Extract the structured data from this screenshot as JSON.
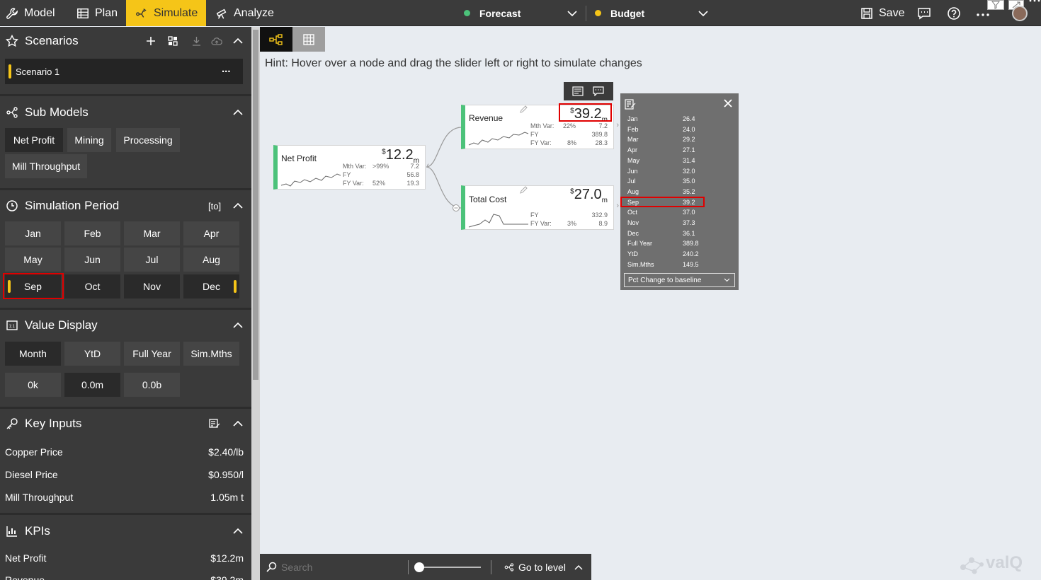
{
  "topbar": {
    "tabs": [
      {
        "label": "Model",
        "icon": "wrench-icon"
      },
      {
        "label": "Plan",
        "icon": "table-icon"
      },
      {
        "label": "Simulate",
        "icon": "simulate-icon"
      },
      {
        "label": "Analyze",
        "icon": "telescope-icon"
      }
    ],
    "forecast_selector": {
      "label": "Forecast",
      "color": "#4cc27a"
    },
    "budget_selector": {
      "label": "Budget",
      "color": "#f5c518"
    },
    "save_label": "Save"
  },
  "sidebar": {
    "scenarios": {
      "title": "Scenarios",
      "items": [
        {
          "label": "Scenario 1",
          "menu": "..."
        }
      ]
    },
    "sub_models": {
      "title": "Sub Models",
      "items": [
        "Net Profit",
        "Mining",
        "Processing",
        "Mill Throughput"
      ]
    },
    "simulation_period": {
      "title": "Simulation Period",
      "mode_label": "[to]",
      "months": [
        "Jan",
        "Feb",
        "Mar",
        "Apr",
        "May",
        "Jun",
        "Jul",
        "Aug",
        "Sep",
        "Oct",
        "Nov",
        "Dec"
      ]
    },
    "value_display": {
      "title": "Value Display",
      "periods": [
        "Month",
        "YtD",
        "Full Year",
        "Sim.Mths"
      ],
      "scales": [
        "0k",
        "0.0m",
        "0.0b"
      ]
    },
    "key_inputs": {
      "title": "Key Inputs",
      "items": [
        {
          "label": "Copper Price",
          "value": "$2.40/lb"
        },
        {
          "label": "Diesel Price",
          "value": "$0.950/l"
        },
        {
          "label": "Mill Throughput",
          "value": "1.05m t"
        }
      ]
    },
    "kpis": {
      "title": "KPIs",
      "items": [
        {
          "label": "Net Profit",
          "value": "$12.2m"
        },
        {
          "label": "Revenue",
          "value": "$39.2m"
        }
      ]
    }
  },
  "canvas": {
    "hint": "Hint: Hover over a node and drag the slider left or right to simulate changes",
    "nodes": {
      "net_profit": {
        "label": "Net Profit",
        "currency": "$",
        "value": "12.2",
        "unit": "m",
        "mth_var_label": "Mth Var:",
        "mth_var_pct": ">99%",
        "mth_var_val": "7.2",
        "fy_label": "FY",
        "fy_val": "56.8",
        "fy_var_label": "FY Var:",
        "fy_var_pct": "52%",
        "fy_var_val": "19.3"
      },
      "revenue": {
        "label": "Revenue",
        "currency": "$",
        "value": "39.2",
        "unit": "m",
        "mth_var_label": "Mth Var:",
        "mth_var_pct": "22%",
        "mth_var_val": "7.2",
        "fy_label": "FY",
        "fy_val": "389.8",
        "fy_var_label": "FY Var:",
        "fy_var_pct": "8%",
        "fy_var_val": "28.3"
      },
      "total_cost": {
        "label": "Total Cost",
        "currency": "$",
        "value": "27.0",
        "unit": "m",
        "fy_label": "FY",
        "fy_val": "332.9",
        "fy_var_label": "FY Var:",
        "fy_var_pct": "3%",
        "fy_var_val": "8.9"
      }
    },
    "tooltip": {
      "rows": [
        {
          "label": "Jan",
          "value": "26.4"
        },
        {
          "label": "Feb",
          "value": "24.0"
        },
        {
          "label": "Mar",
          "value": "29.2"
        },
        {
          "label": "Apr",
          "value": "27.1"
        },
        {
          "label": "May",
          "value": "31.4"
        },
        {
          "label": "Jun",
          "value": "32.0"
        },
        {
          "label": "Jul",
          "value": "35.0"
        },
        {
          "label": "Aug",
          "value": "35.2"
        },
        {
          "label": "Sep",
          "value": "39.2"
        },
        {
          "label": "Oct",
          "value": "37.0"
        },
        {
          "label": "Nov",
          "value": "37.3"
        },
        {
          "label": "Dec",
          "value": "36.1"
        },
        {
          "label": "Full Year",
          "value": "389.8"
        },
        {
          "label": "YtD",
          "value": "240.2"
        },
        {
          "label": "Sim.Mths",
          "value": "149.5"
        }
      ],
      "dropdown_label": "Pct Change to baseline"
    }
  },
  "bottombar": {
    "search_placeholder": "Search",
    "go_to_level_label": "Go to level"
  },
  "brand": {
    "logo_text": "valQ"
  }
}
